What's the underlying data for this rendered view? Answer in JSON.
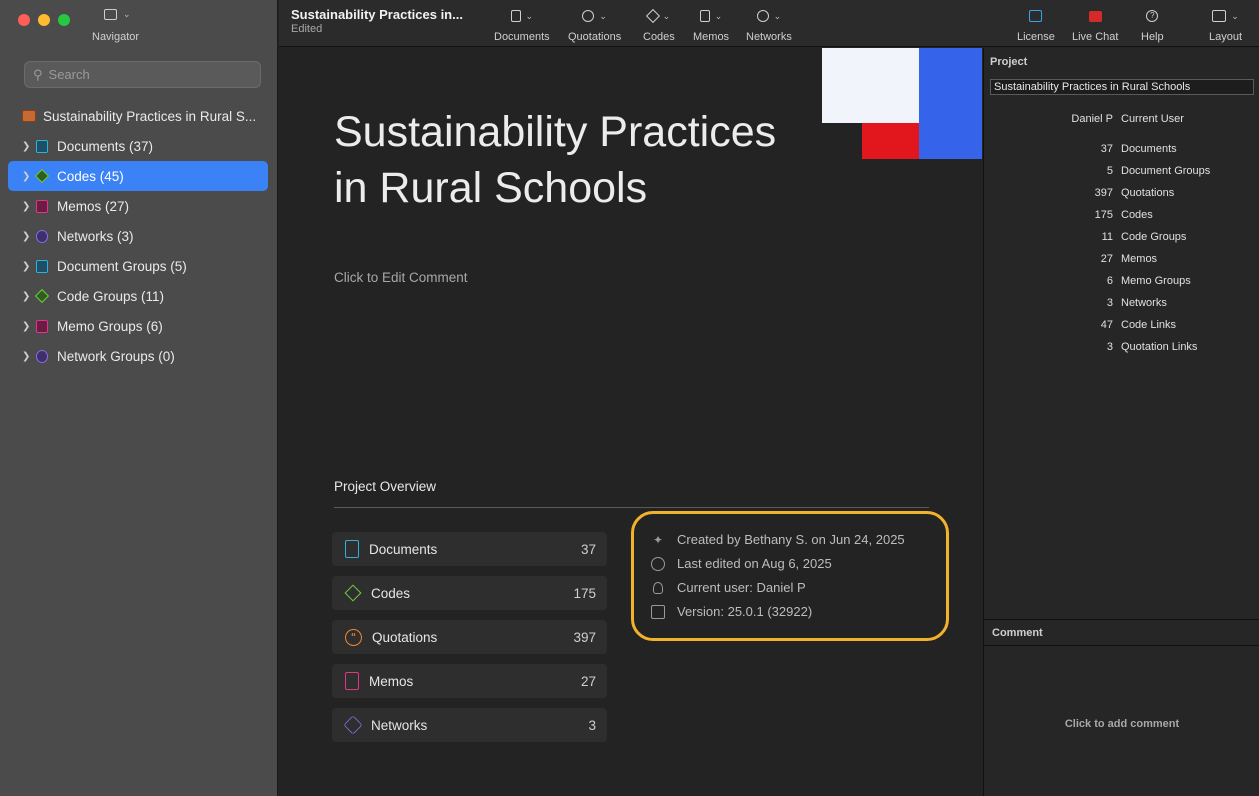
{
  "sidebar": {
    "nav_label": "Navigator",
    "search_placeholder": "Search",
    "items": [
      {
        "label": "Sustainability Practices in Rural S...",
        "icon": "project-icon"
      },
      {
        "label": "Documents (37)",
        "icon": "document-icon"
      },
      {
        "label": "Codes (45)",
        "icon": "code-icon",
        "selected": true
      },
      {
        "label": "Memos (27)",
        "icon": "memo-icon"
      },
      {
        "label": "Networks (3)",
        "icon": "network-icon"
      },
      {
        "label": "Document Groups (5)",
        "icon": "document-icon"
      },
      {
        "label": "Code Groups (11)",
        "icon": "code-icon"
      },
      {
        "label": "Memo Groups (6)",
        "icon": "memo-icon"
      },
      {
        "label": "Network Groups (0)",
        "icon": "network-icon"
      }
    ]
  },
  "toolbar": {
    "title": "Sustainability Practices in...",
    "subtitle": "Edited",
    "buttons": [
      "Documents",
      "Quotations",
      "Codes",
      "Memos",
      "Networks"
    ],
    "right_buttons": [
      "License",
      "Live Chat",
      "Help",
      "Layout"
    ]
  },
  "main": {
    "title_line1": "Sustainability Practices",
    "title_line2": "in Rural Schools",
    "edit_comment": "Click to Edit Comment",
    "overview_title": "Project Overview",
    "overview": [
      {
        "name": "Documents",
        "value": "37"
      },
      {
        "name": "Codes",
        "value": "175"
      },
      {
        "name": "Quotations",
        "value": "397"
      },
      {
        "name": "Memos",
        "value": "27"
      },
      {
        "name": "Networks",
        "value": "3"
      }
    ],
    "info": {
      "created": "Created by Bethany S. on Jun 24, 2025",
      "edited": "Last edited on Aug 6, 2025",
      "user": "Current user: Daniel P",
      "version": "Version: 25.0.1 (32922)"
    },
    "colors": {
      "accent_box": "#f2b22c",
      "deco_blue": "#3563e9",
      "deco_red": "#e2171e"
    }
  },
  "right": {
    "head": "Project",
    "project_name": "Sustainability Practices in Rural Schools",
    "user_value": "Daniel P",
    "user_label": "Current User",
    "stats": [
      {
        "n": "37",
        "label": "Documents"
      },
      {
        "n": "5",
        "label": "Document Groups"
      },
      {
        "n": "397",
        "label": "Quotations"
      },
      {
        "n": "175",
        "label": "Codes"
      },
      {
        "n": "11",
        "label": "Code Groups"
      },
      {
        "n": "27",
        "label": "Memos"
      },
      {
        "n": "6",
        "label": "Memo Groups"
      },
      {
        "n": "3",
        "label": "Networks"
      },
      {
        "n": "47",
        "label": "Code Links"
      },
      {
        "n": "3",
        "label": "Quotation Links"
      }
    ],
    "comment_head": "Comment",
    "comment_placeholder": "Click to add comment"
  }
}
